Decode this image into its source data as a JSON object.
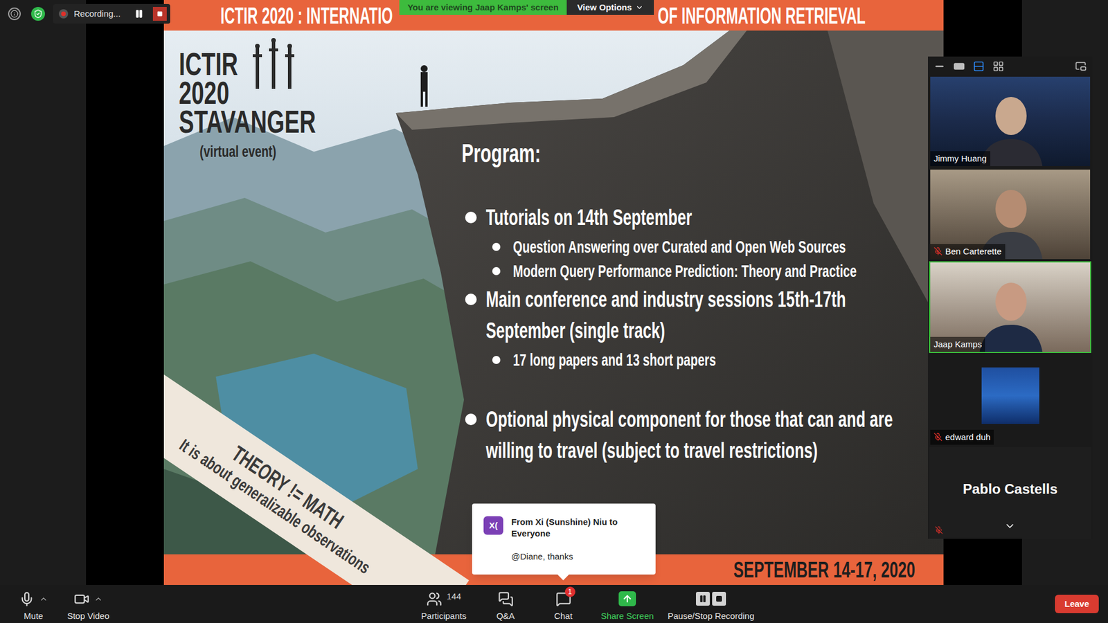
{
  "status": {
    "recording_label": "Recording...",
    "recording": true
  },
  "share_banner": {
    "text": "You are viewing Jaap Kamps' screen",
    "view_options": "View Options"
  },
  "slide": {
    "header_left": "ICTIR 2020 : INTERNATIO",
    "header_right": "OF INFORMATION RETRIEVAL",
    "logo_lines": [
      "ICTIR",
      "2020",
      "STAVANGER"
    ],
    "logo_subtitle": "(virtual event)",
    "program_title": "Program:",
    "bullets": [
      {
        "text": "Tutorials on 14th September",
        "level": 1
      },
      {
        "text": "Question Answering over Curated and Open Web Sources",
        "level": 2
      },
      {
        "text": "Modern Query Performance Prediction: Theory and Practice",
        "level": 2
      },
      {
        "text": "Main conference and industry sessions 15th-17th September (single track)",
        "level": 1
      },
      {
        "text": "17 long papers and 13 short papers",
        "level": 2
      },
      {
        "text": "Optional physical component for those that can and are willing to travel (subject to travel restrictions)",
        "level": 1
      }
    ],
    "ribbon": [
      "THEORY != MATH",
      "It is about generalizable observations"
    ],
    "footer": "SEPTEMBER 14-17, 2020"
  },
  "gallery": {
    "views": [
      {
        "kind": "minimize",
        "selected": false
      },
      {
        "kind": "speaker",
        "selected": false
      },
      {
        "kind": "strip",
        "selected": true
      },
      {
        "kind": "grid",
        "selected": false
      }
    ],
    "participants": [
      {
        "name": "Jimmy Huang",
        "muted": false,
        "speaking": false,
        "kind": "video"
      },
      {
        "name": "Ben Carterette",
        "muted": true,
        "speaking": false,
        "kind": "video"
      },
      {
        "name": "Jaap Kamps",
        "muted": false,
        "speaking": true,
        "kind": "video"
      },
      {
        "name": "edward duh",
        "muted": true,
        "speaking": false,
        "kind": "avatar"
      },
      {
        "name": "Pablo Castells",
        "muted": true,
        "speaking": false,
        "kind": "name"
      }
    ]
  },
  "chat_popup": {
    "initials": "X(",
    "from": "From Xi (Sunshine) Niu to Everyone",
    "message": "@Diane, thanks"
  },
  "toolbar": {
    "buttons": [
      {
        "kind": "mic",
        "label": "Mute",
        "group": "left",
        "caret": true,
        "count": "",
        "badge": ""
      },
      {
        "kind": "video",
        "label": "Stop Video",
        "group": "left",
        "caret": true,
        "count": "",
        "badge": ""
      },
      {
        "kind": "participants",
        "label": "Participants",
        "group": "center",
        "caret": false,
        "count": "144",
        "badge": ""
      },
      {
        "kind": "qa",
        "label": "Q&A",
        "group": "center",
        "caret": false,
        "count": "",
        "badge": ""
      },
      {
        "kind": "chat",
        "label": "Chat",
        "group": "center",
        "caret": false,
        "count": "",
        "badge": "1"
      },
      {
        "kind": "share",
        "label": "Share Screen",
        "group": "center",
        "caret": false,
        "count": "",
        "badge": ""
      },
      {
        "kind": "record",
        "label": "Pause/Stop Recording",
        "group": "center",
        "caret": false,
        "count": "",
        "badge": ""
      }
    ],
    "leave": "Leave"
  }
}
